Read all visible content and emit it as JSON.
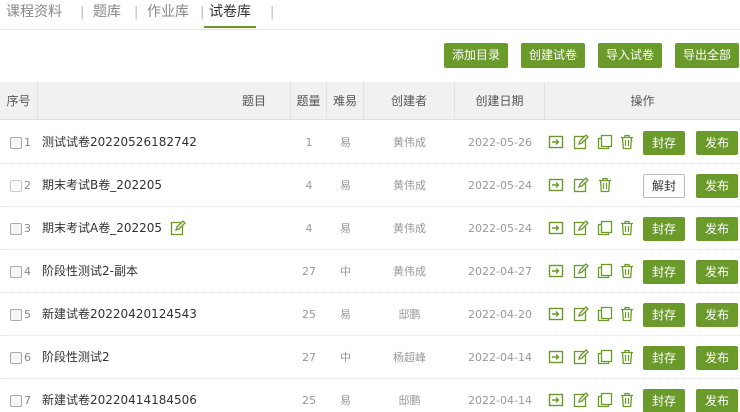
{
  "tabs": [
    "课程资料",
    "题库",
    "作业库",
    "试卷库"
  ],
  "toolbar": {
    "add_dir": "添加目录",
    "create": "创建试卷",
    "import": "导入试卷",
    "export_all": "导出全部"
  },
  "columns": {
    "idx": "序号",
    "title": "题目",
    "count": "题量",
    "difficulty": "难易",
    "creator": "创建者",
    "date": "创建日期",
    "ops": "操作"
  },
  "rows": [
    {
      "idx": "1",
      "title": "测试试卷20220526182742",
      "count": "1",
      "difficulty": "易",
      "creator": "黄伟成",
      "date": "2022-05-26",
      "action": "封存",
      "publish": "发布",
      "disabled": false,
      "has_copy": true,
      "has_edit_mark": false
    },
    {
      "idx": "2",
      "title": "期末考试B卷_202205",
      "count": "4",
      "difficulty": "易",
      "creator": "黄伟成",
      "date": "2022-05-24",
      "action": "解封",
      "publish": "发布",
      "disabled": true,
      "has_copy": false,
      "has_edit_mark": false
    },
    {
      "idx": "3",
      "title": "期末考试A卷_202205",
      "count": "4",
      "difficulty": "易",
      "creator": "黄伟成",
      "date": "2022-05-24",
      "action": "封存",
      "publish": "发布",
      "disabled": false,
      "has_copy": true,
      "has_edit_mark": true
    },
    {
      "idx": "4",
      "title": "阶段性测试2-副本",
      "count": "27",
      "difficulty": "中",
      "creator": "黄伟成",
      "date": "2022-04-27",
      "action": "封存",
      "publish": "发布",
      "disabled": false,
      "has_copy": true,
      "has_edit_mark": false
    },
    {
      "idx": "5",
      "title": "新建试卷20220420124543",
      "count": "25",
      "difficulty": "易",
      "creator": "邸鹏",
      "date": "2022-04-20",
      "action": "封存",
      "publish": "发布",
      "disabled": false,
      "has_copy": true,
      "has_edit_mark": false
    },
    {
      "idx": "6",
      "title": "阶段性测试2",
      "count": "27",
      "difficulty": "中",
      "creator": "杨超峰",
      "date": "2022-04-14",
      "action": "封存",
      "publish": "发布",
      "disabled": false,
      "has_copy": true,
      "has_edit_mark": false
    },
    {
      "idx": "7",
      "title": "新建试卷20220414184506",
      "count": "25",
      "difficulty": "易",
      "creator": "邸鹏",
      "date": "2022-04-14",
      "action": "封存",
      "publish": "发布",
      "disabled": false,
      "has_copy": true,
      "has_edit_mark": false
    }
  ],
  "colors": {
    "accent": "#6a9a2a",
    "header_bg": "#f1f1f1"
  }
}
